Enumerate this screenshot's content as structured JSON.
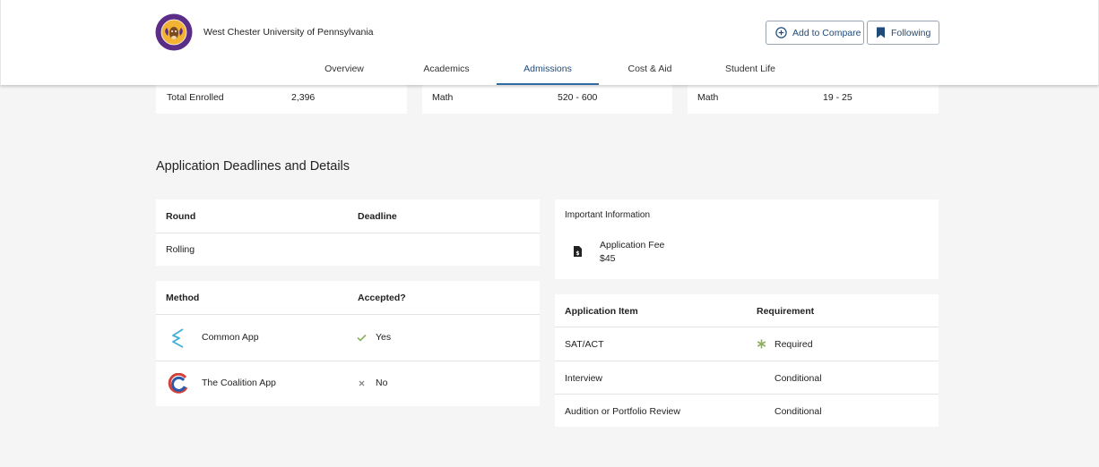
{
  "header": {
    "school_name": "West Chester University of Pennsylvania",
    "compare_label": "Add to Compare",
    "following_label": "Following",
    "logo_icon": "ram-seal-logo"
  },
  "nav": {
    "tabs": [
      {
        "label": "Overview",
        "active": false
      },
      {
        "label": "Academics",
        "active": false
      },
      {
        "label": "Admissions",
        "active": true
      },
      {
        "label": "Cost & Aid",
        "active": false
      },
      {
        "label": "Student Life",
        "active": false
      }
    ]
  },
  "stats_row": {
    "enrolled": {
      "label": "Total Enrolled",
      "value": "2,396"
    },
    "sat_math": {
      "label": "Math",
      "value": "520 - 600"
    },
    "act_math": {
      "label": "Math",
      "value": "19 - 25"
    }
  },
  "section_title": "Application Deadlines and Details",
  "deadlines": {
    "headers": {
      "round": "Round",
      "deadline": "Deadline"
    },
    "rows": [
      {
        "round": "Rolling",
        "deadline": ""
      }
    ]
  },
  "methods": {
    "headers": {
      "method": "Method",
      "accepted": "Accepted?"
    },
    "rows": [
      {
        "name": "Common App",
        "accepted": "Yes",
        "icon": "common-app-icon",
        "status_icon": "check-icon"
      },
      {
        "name": "The Coalition App",
        "accepted": "No",
        "icon": "coalition-app-icon",
        "status_icon": "x-icon"
      }
    ]
  },
  "important_info": {
    "title": "Important Information",
    "fee_label": "Application Fee",
    "fee_value": "$45",
    "icon": "fee-document-icon"
  },
  "requirements": {
    "headers": {
      "item": "Application Item",
      "requirement": "Requirement"
    },
    "rows": [
      {
        "item": "SAT/ACT",
        "requirement": "Required",
        "icon": "asterisk-icon"
      },
      {
        "item": "Interview",
        "requirement": "Conditional"
      },
      {
        "item": "Audition or Portfolio Review",
        "requirement": "Conditional"
      }
    ]
  },
  "colors": {
    "accent": "#1f4a7a",
    "check": "#8ab05a",
    "asterisk": "#8ab05a"
  }
}
